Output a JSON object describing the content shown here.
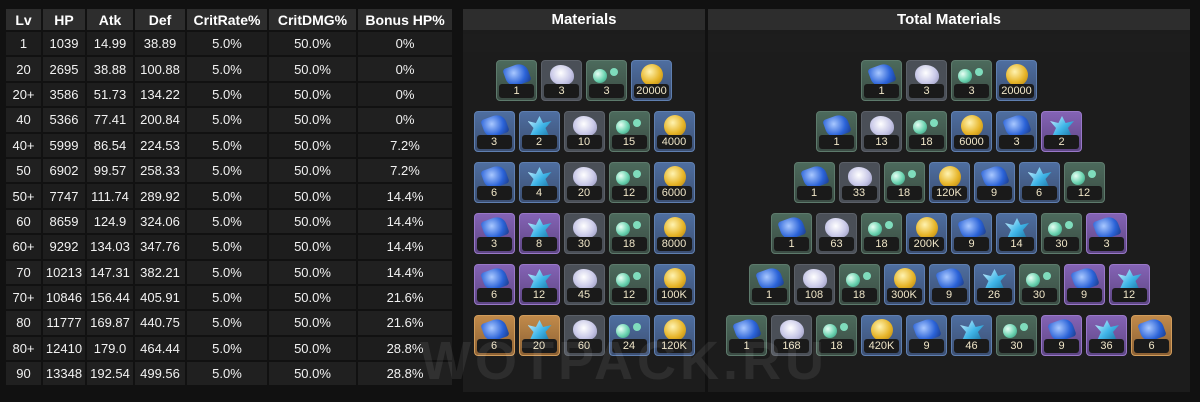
{
  "stats": {
    "headers": [
      "Lv",
      "HP",
      "Atk",
      "Def",
      "CritRate%",
      "CritDMG%",
      "Bonus HP%"
    ],
    "rows": [
      [
        "1",
        "1039",
        "14.99",
        "38.89",
        "5.0%",
        "50.0%",
        "0%"
      ],
      [
        "20",
        "2695",
        "38.88",
        "100.88",
        "5.0%",
        "50.0%",
        "0%"
      ],
      [
        "20+",
        "3586",
        "51.73",
        "134.22",
        "5.0%",
        "50.0%",
        "0%"
      ],
      [
        "40",
        "5366",
        "77.41",
        "200.84",
        "5.0%",
        "50.0%",
        "0%"
      ],
      [
        "40+",
        "5999",
        "86.54",
        "224.53",
        "5.0%",
        "50.0%",
        "7.2%"
      ],
      [
        "50",
        "6902",
        "99.57",
        "258.33",
        "5.0%",
        "50.0%",
        "7.2%"
      ],
      [
        "50+",
        "7747",
        "111.74",
        "289.92",
        "5.0%",
        "50.0%",
        "14.4%"
      ],
      [
        "60",
        "8659",
        "124.9",
        "324.06",
        "5.0%",
        "50.0%",
        "14.4%"
      ],
      [
        "60+",
        "9292",
        "134.03",
        "347.76",
        "5.0%",
        "50.0%",
        "14.4%"
      ],
      [
        "70",
        "10213",
        "147.31",
        "382.21",
        "5.0%",
        "50.0%",
        "14.4%"
      ],
      [
        "70+",
        "10846",
        "156.44",
        "405.91",
        "5.0%",
        "50.0%",
        "21.6%"
      ],
      [
        "80",
        "11777",
        "169.87",
        "440.75",
        "5.0%",
        "50.0%",
        "21.6%"
      ],
      [
        "80+",
        "12410",
        "179.0",
        "464.44",
        "5.0%",
        "50.0%",
        "28.8%"
      ],
      [
        "90",
        "13348",
        "192.54",
        "499.56",
        "5.0%",
        "50.0%",
        "28.8%"
      ]
    ]
  },
  "materials": {
    "title": "Materials",
    "groups": [
      [
        {
          "icon": "gem",
          "rarity": 2,
          "count": "1"
        },
        {
          "icon": "ore",
          "rarity": 1,
          "count": "3"
        },
        {
          "icon": "pearl",
          "rarity": 2,
          "count": "3"
        },
        {
          "icon": "coin",
          "rarity": 3,
          "count": "20000"
        }
      ],
      [
        {
          "icon": "gem",
          "rarity": 3,
          "count": "3"
        },
        {
          "icon": "crystal",
          "rarity": 3,
          "count": "2"
        },
        {
          "icon": "ore",
          "rarity": 1,
          "count": "10"
        },
        {
          "icon": "pearl",
          "rarity": 2,
          "count": "15"
        },
        {
          "icon": "coin",
          "rarity": 3,
          "count": "4000"
        }
      ],
      [
        {
          "icon": "gem",
          "rarity": 3,
          "count": "6"
        },
        {
          "icon": "crystal",
          "rarity": 3,
          "count": "4"
        },
        {
          "icon": "ore",
          "rarity": 1,
          "count": "20"
        },
        {
          "icon": "pearl",
          "rarity": 2,
          "count": "12"
        },
        {
          "icon": "coin",
          "rarity": 3,
          "count": "6000"
        }
      ],
      [
        {
          "icon": "gem",
          "rarity": 4,
          "count": "3"
        },
        {
          "icon": "crystal",
          "rarity": 4,
          "count": "8"
        },
        {
          "icon": "ore",
          "rarity": 1,
          "count": "30"
        },
        {
          "icon": "pearl",
          "rarity": 2,
          "count": "18"
        },
        {
          "icon": "coin",
          "rarity": 3,
          "count": "8000"
        }
      ],
      [
        {
          "icon": "gem",
          "rarity": 4,
          "count": "6"
        },
        {
          "icon": "crystal",
          "rarity": 4,
          "count": "12"
        },
        {
          "icon": "ore",
          "rarity": 1,
          "count": "45"
        },
        {
          "icon": "pearl",
          "rarity": 2,
          "count": "12"
        },
        {
          "icon": "coin",
          "rarity": 3,
          "count": "100K"
        }
      ],
      [
        {
          "icon": "gem",
          "rarity": 5,
          "count": "6"
        },
        {
          "icon": "crystal",
          "rarity": 5,
          "count": "20"
        },
        {
          "icon": "ore",
          "rarity": 1,
          "count": "60"
        },
        {
          "icon": "pearl",
          "rarity": 3,
          "count": "24"
        },
        {
          "icon": "coin",
          "rarity": 3,
          "count": "120K"
        }
      ]
    ]
  },
  "total_materials": {
    "title": "Total Materials",
    "groups": [
      [
        {
          "icon": "gem",
          "rarity": 2,
          "count": "1"
        },
        {
          "icon": "ore",
          "rarity": 1,
          "count": "3"
        },
        {
          "icon": "pearl",
          "rarity": 2,
          "count": "3"
        },
        {
          "icon": "coin",
          "rarity": 3,
          "count": "20000"
        }
      ],
      [
        {
          "icon": "gem",
          "rarity": 2,
          "count": "1"
        },
        {
          "icon": "ore",
          "rarity": 1,
          "count": "13"
        },
        {
          "icon": "pearl",
          "rarity": 2,
          "count": "18"
        },
        {
          "icon": "coin",
          "rarity": 3,
          "count": "6000"
        },
        {
          "icon": "gem",
          "rarity": 3,
          "count": "3"
        },
        {
          "icon": "crystal",
          "rarity": 4,
          "count": "2"
        }
      ],
      [
        {
          "icon": "gem",
          "rarity": 2,
          "count": "1"
        },
        {
          "icon": "ore",
          "rarity": 1,
          "count": "33"
        },
        {
          "icon": "pearl",
          "rarity": 2,
          "count": "18"
        },
        {
          "icon": "coin",
          "rarity": 3,
          "count": "120K"
        },
        {
          "icon": "gem",
          "rarity": 3,
          "count": "9"
        },
        {
          "icon": "crystal",
          "rarity": 3,
          "count": "6"
        },
        {
          "icon": "pearl",
          "rarity": 2,
          "count": "12"
        }
      ],
      [
        {
          "icon": "gem",
          "rarity": 2,
          "count": "1"
        },
        {
          "icon": "ore",
          "rarity": 1,
          "count": "63"
        },
        {
          "icon": "pearl",
          "rarity": 2,
          "count": "18"
        },
        {
          "icon": "coin",
          "rarity": 3,
          "count": "200K"
        },
        {
          "icon": "gem",
          "rarity": 3,
          "count": "9"
        },
        {
          "icon": "crystal",
          "rarity": 3,
          "count": "14"
        },
        {
          "icon": "pearl",
          "rarity": 2,
          "count": "30"
        },
        {
          "icon": "gem",
          "rarity": 4,
          "count": "3"
        }
      ],
      [
        {
          "icon": "gem",
          "rarity": 2,
          "count": "1"
        },
        {
          "icon": "ore",
          "rarity": 1,
          "count": "108"
        },
        {
          "icon": "pearl",
          "rarity": 2,
          "count": "18"
        },
        {
          "icon": "coin",
          "rarity": 3,
          "count": "300K"
        },
        {
          "icon": "gem",
          "rarity": 3,
          "count": "9"
        },
        {
          "icon": "crystal",
          "rarity": 3,
          "count": "26"
        },
        {
          "icon": "pearl",
          "rarity": 2,
          "count": "30"
        },
        {
          "icon": "gem",
          "rarity": 4,
          "count": "9"
        },
        {
          "icon": "crystal",
          "rarity": 4,
          "count": "12"
        }
      ],
      [
        {
          "icon": "gem",
          "rarity": 2,
          "count": "1"
        },
        {
          "icon": "ore",
          "rarity": 1,
          "count": "168"
        },
        {
          "icon": "pearl",
          "rarity": 2,
          "count": "18"
        },
        {
          "icon": "coin",
          "rarity": 3,
          "count": "420K"
        },
        {
          "icon": "gem",
          "rarity": 3,
          "count": "9"
        },
        {
          "icon": "crystal",
          "rarity": 3,
          "count": "46"
        },
        {
          "icon": "pearl",
          "rarity": 2,
          "count": "30"
        },
        {
          "icon": "gem",
          "rarity": 4,
          "count": "9"
        },
        {
          "icon": "crystal",
          "rarity": 4,
          "count": "36"
        },
        {
          "icon": "gem",
          "rarity": 5,
          "count": "6"
        }
      ]
    ]
  },
  "watermark": "WOTPACK.RU"
}
